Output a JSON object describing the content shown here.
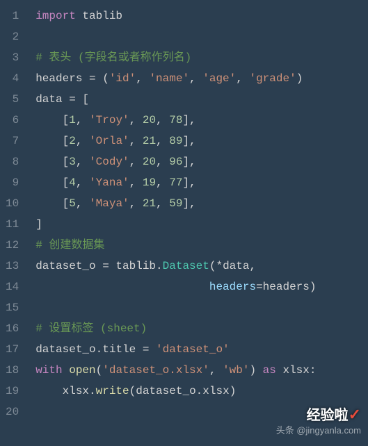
{
  "lines": [
    {
      "n": 1,
      "tokens": [
        {
          "t": "import",
          "c": "tk-keyword"
        },
        {
          "t": " ",
          "c": ""
        },
        {
          "t": "tablib",
          "c": "tk-module"
        }
      ]
    },
    {
      "n": 2,
      "tokens": []
    },
    {
      "n": 3,
      "tokens": [
        {
          "t": "# 表头 (字段名或者称作列名)",
          "c": "tk-comment"
        }
      ]
    },
    {
      "n": 4,
      "tokens": [
        {
          "t": "headers ",
          "c": "tk-var"
        },
        {
          "t": "= (",
          "c": "tk-op"
        },
        {
          "t": "'id'",
          "c": "tk-string2"
        },
        {
          "t": ", ",
          "c": "tk-punc"
        },
        {
          "t": "'name'",
          "c": "tk-string2"
        },
        {
          "t": ", ",
          "c": "tk-punc"
        },
        {
          "t": "'age'",
          "c": "tk-string2"
        },
        {
          "t": ", ",
          "c": "tk-punc"
        },
        {
          "t": "'grade'",
          "c": "tk-string2"
        },
        {
          "t": ")",
          "c": "tk-op"
        }
      ]
    },
    {
      "n": 5,
      "tokens": [
        {
          "t": "data ",
          "c": "tk-var"
        },
        {
          "t": "= [",
          "c": "tk-op"
        }
      ]
    },
    {
      "n": 6,
      "tokens": [
        {
          "t": "    [",
          "c": "tk-op"
        },
        {
          "t": "1",
          "c": "tk-number"
        },
        {
          "t": ", ",
          "c": "tk-punc"
        },
        {
          "t": "'Troy'",
          "c": "tk-string2"
        },
        {
          "t": ", ",
          "c": "tk-punc"
        },
        {
          "t": "20",
          "c": "tk-number"
        },
        {
          "t": ", ",
          "c": "tk-punc"
        },
        {
          "t": "78",
          "c": "tk-number"
        },
        {
          "t": "],",
          "c": "tk-op"
        }
      ]
    },
    {
      "n": 7,
      "tokens": [
        {
          "t": "    [",
          "c": "tk-op"
        },
        {
          "t": "2",
          "c": "tk-number"
        },
        {
          "t": ", ",
          "c": "tk-punc"
        },
        {
          "t": "'Orla'",
          "c": "tk-string2"
        },
        {
          "t": ", ",
          "c": "tk-punc"
        },
        {
          "t": "21",
          "c": "tk-number"
        },
        {
          "t": ", ",
          "c": "tk-punc"
        },
        {
          "t": "89",
          "c": "tk-number"
        },
        {
          "t": "],",
          "c": "tk-op"
        }
      ]
    },
    {
      "n": 8,
      "tokens": [
        {
          "t": "    [",
          "c": "tk-op"
        },
        {
          "t": "3",
          "c": "tk-number"
        },
        {
          "t": ", ",
          "c": "tk-punc"
        },
        {
          "t": "'Cody'",
          "c": "tk-string2"
        },
        {
          "t": ", ",
          "c": "tk-punc"
        },
        {
          "t": "20",
          "c": "tk-number"
        },
        {
          "t": ", ",
          "c": "tk-punc"
        },
        {
          "t": "96",
          "c": "tk-number"
        },
        {
          "t": "],",
          "c": "tk-op"
        }
      ]
    },
    {
      "n": 9,
      "tokens": [
        {
          "t": "    [",
          "c": "tk-op"
        },
        {
          "t": "4",
          "c": "tk-number"
        },
        {
          "t": ", ",
          "c": "tk-punc"
        },
        {
          "t": "'Yana'",
          "c": "tk-string2"
        },
        {
          "t": ", ",
          "c": "tk-punc"
        },
        {
          "t": "19",
          "c": "tk-number"
        },
        {
          "t": ", ",
          "c": "tk-punc"
        },
        {
          "t": "77",
          "c": "tk-number"
        },
        {
          "t": "],",
          "c": "tk-op"
        }
      ]
    },
    {
      "n": 10,
      "tokens": [
        {
          "t": "    [",
          "c": "tk-op"
        },
        {
          "t": "5",
          "c": "tk-number"
        },
        {
          "t": ", ",
          "c": "tk-punc"
        },
        {
          "t": "'Maya'",
          "c": "tk-string2"
        },
        {
          "t": ", ",
          "c": "tk-punc"
        },
        {
          "t": "21",
          "c": "tk-number"
        },
        {
          "t": ", ",
          "c": "tk-punc"
        },
        {
          "t": "59",
          "c": "tk-number"
        },
        {
          "t": "],",
          "c": "tk-op"
        }
      ]
    },
    {
      "n": 11,
      "tokens": [
        {
          "t": "]",
          "c": "tk-op"
        }
      ]
    },
    {
      "n": 12,
      "tokens": [
        {
          "t": "# 创建数据集",
          "c": "tk-comment"
        }
      ]
    },
    {
      "n": 13,
      "tokens": [
        {
          "t": "dataset_o ",
          "c": "tk-var"
        },
        {
          "t": "= ",
          "c": "tk-op"
        },
        {
          "t": "tablib",
          "c": "tk-var"
        },
        {
          "t": ".",
          "c": "tk-punc"
        },
        {
          "t": "Dataset",
          "c": "tk-builtin"
        },
        {
          "t": "(*",
          "c": "tk-op"
        },
        {
          "t": "data",
          "c": "tk-var"
        },
        {
          "t": ",",
          "c": "tk-punc"
        }
      ]
    },
    {
      "n": 14,
      "tokens": [
        {
          "t": "                          ",
          "c": ""
        },
        {
          "t": "headers",
          "c": "tk-param"
        },
        {
          "t": "=",
          "c": "tk-op"
        },
        {
          "t": "headers",
          "c": "tk-var"
        },
        {
          "t": ")",
          "c": "tk-op"
        }
      ]
    },
    {
      "n": 15,
      "tokens": []
    },
    {
      "n": 16,
      "tokens": [
        {
          "t": "# 设置标签 (sheet)",
          "c": "tk-comment"
        }
      ]
    },
    {
      "n": 17,
      "tokens": [
        {
          "t": "dataset_o",
          "c": "tk-var"
        },
        {
          "t": ".",
          "c": "tk-punc"
        },
        {
          "t": "title ",
          "c": "tk-var"
        },
        {
          "t": "= ",
          "c": "tk-op"
        },
        {
          "t": "'dataset_o'",
          "c": "tk-string2"
        }
      ]
    },
    {
      "n": 18,
      "tokens": [
        {
          "t": "with",
          "c": "tk-keyword"
        },
        {
          "t": " ",
          "c": ""
        },
        {
          "t": "open",
          "c": "tk-func"
        },
        {
          "t": "(",
          "c": "tk-op"
        },
        {
          "t": "'dataset_o.xlsx'",
          "c": "tk-string2"
        },
        {
          "t": ", ",
          "c": "tk-punc"
        },
        {
          "t": "'wb'",
          "c": "tk-string2"
        },
        {
          "t": ") ",
          "c": "tk-op"
        },
        {
          "t": "as",
          "c": "tk-keyword"
        },
        {
          "t": " xlsx:",
          "c": "tk-var"
        }
      ]
    },
    {
      "n": 19,
      "tokens": [
        {
          "t": "    xlsx",
          "c": "tk-var"
        },
        {
          "t": ".",
          "c": "tk-punc"
        },
        {
          "t": "write",
          "c": "tk-func"
        },
        {
          "t": "(",
          "c": "tk-op"
        },
        {
          "t": "dataset_o",
          "c": "tk-var"
        },
        {
          "t": ".",
          "c": "tk-punc"
        },
        {
          "t": "xlsx",
          "c": "tk-var"
        },
        {
          "t": ")",
          "c": "tk-op"
        }
      ]
    },
    {
      "n": 20,
      "tokens": []
    }
  ],
  "watermark": {
    "text1": "经验啦",
    "check": "✓",
    "text2": "头条 @jingyanla.com"
  }
}
